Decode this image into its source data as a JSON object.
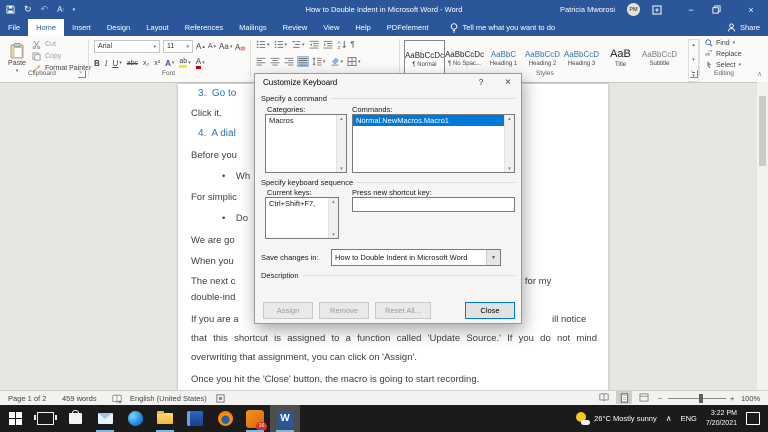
{
  "title_bar": {
    "title": "How to Double Indent in Microsoft Word  -  Word",
    "user_name": "Patricia Mworosi",
    "user_initials": "PM"
  },
  "ribbon": {
    "tabs": [
      {
        "label": "File"
      },
      {
        "label": "Home"
      },
      {
        "label": "Insert"
      },
      {
        "label": "Design"
      },
      {
        "label": "Layout"
      },
      {
        "label": "References"
      },
      {
        "label": "Mailings"
      },
      {
        "label": "Review"
      },
      {
        "label": "View"
      },
      {
        "label": "Help"
      },
      {
        "label": "PDFelement"
      }
    ],
    "tell_me": "Tell me what you want to do",
    "share": "Share",
    "clipboard": {
      "label": "Clipboard",
      "paste": "Paste",
      "cut": "Cut",
      "copy": "Copy",
      "format_painter": "Format Painter"
    },
    "font_group": {
      "label": "Font",
      "family": "Arial",
      "size": "11",
      "grow": "A",
      "shrink": "A",
      "case": "Aa",
      "bold": "B",
      "italic": "I",
      "underline": "U",
      "strike": "abc",
      "sub": "x₂",
      "sup": "x²",
      "effects": "A",
      "highlight": "ab",
      "color": "A"
    },
    "paragraph_group": {
      "pilcrow": "¶"
    },
    "styles": {
      "label": "Styles",
      "items": [
        {
          "preview": "AaBbCcDc",
          "name": "¶ Normal"
        },
        {
          "preview": "AaBbCcDc",
          "name": "¶ No Spac..."
        },
        {
          "preview": "AaBbC",
          "name": "Heading 1"
        },
        {
          "preview": "AaBbCcD",
          "name": "Heading 2"
        },
        {
          "preview": "AaBbCcD",
          "name": "Heading 3"
        },
        {
          "preview": "AaB",
          "name": "Title"
        },
        {
          "preview": "AaBbCcD",
          "name": "Subtitle"
        }
      ]
    },
    "editing": {
      "label": "Editing",
      "find": "Find",
      "replace": "Replace",
      "select": "Select"
    }
  },
  "dialog": {
    "title": "Customize Keyboard",
    "help": "?",
    "close_x": "×",
    "specify_command": "Specify a command",
    "categories_label": "Categories:",
    "category_0": "Macros",
    "commands_label": "Commands:",
    "command_0": "Normal.NewMacros.Macro1",
    "specify_sequence": "Specify keyboard sequence",
    "current_keys_label": "Current keys:",
    "current_key_0": "Ctrl+Shift+F7,",
    "press_new_label": "Press new shortcut key:",
    "new_key_value": "",
    "save_in_label": "Save changes in:",
    "save_in_value": "How to Double Indent in Microsoft Word",
    "description_label": "Description",
    "assign": "Assign",
    "remove": "Remove",
    "reset_all": "Reset All...",
    "close": "Close"
  },
  "document": {
    "fragments": [
      {
        "text": "3.  Go to"
      },
      {
        "text": "Click it."
      },
      {
        "text": "4.  A dial"
      },
      {
        "text": "Before you"
      },
      {
        "text": "•    Wh"
      },
      {
        "text": "For simplic"
      },
      {
        "text": "•    Do"
      },
      {
        "text": "We are go"
      },
      {
        "text": "When you"
      },
      {
        "text": "The next c"
      },
      {
        "text": "e for my"
      },
      {
        "text": "double-ind"
      },
      {
        "text": "If you are a"
      },
      {
        "text": "ill notice"
      },
      {
        "text": "that this shortcut is assigned to a function called 'Update Source.' If you do not mind"
      },
      {
        "text": "overwriting that assignment, you can click on 'Assign'."
      },
      {
        "text": "Once you hit the 'Close' button, the macro is going to start recording."
      }
    ]
  },
  "status_bar": {
    "page": "Page 1 of 2",
    "words": "459 words",
    "language": "English (United States)",
    "zoom_out": "−",
    "zoom_in": "+",
    "zoom_level": "100%"
  },
  "taskbar": {
    "weather": "26°C  Mostly sunny",
    "tray_lang": "ENG",
    "time": "3:22 PM",
    "date": "7/20/2021",
    "badge_count": "16"
  }
}
